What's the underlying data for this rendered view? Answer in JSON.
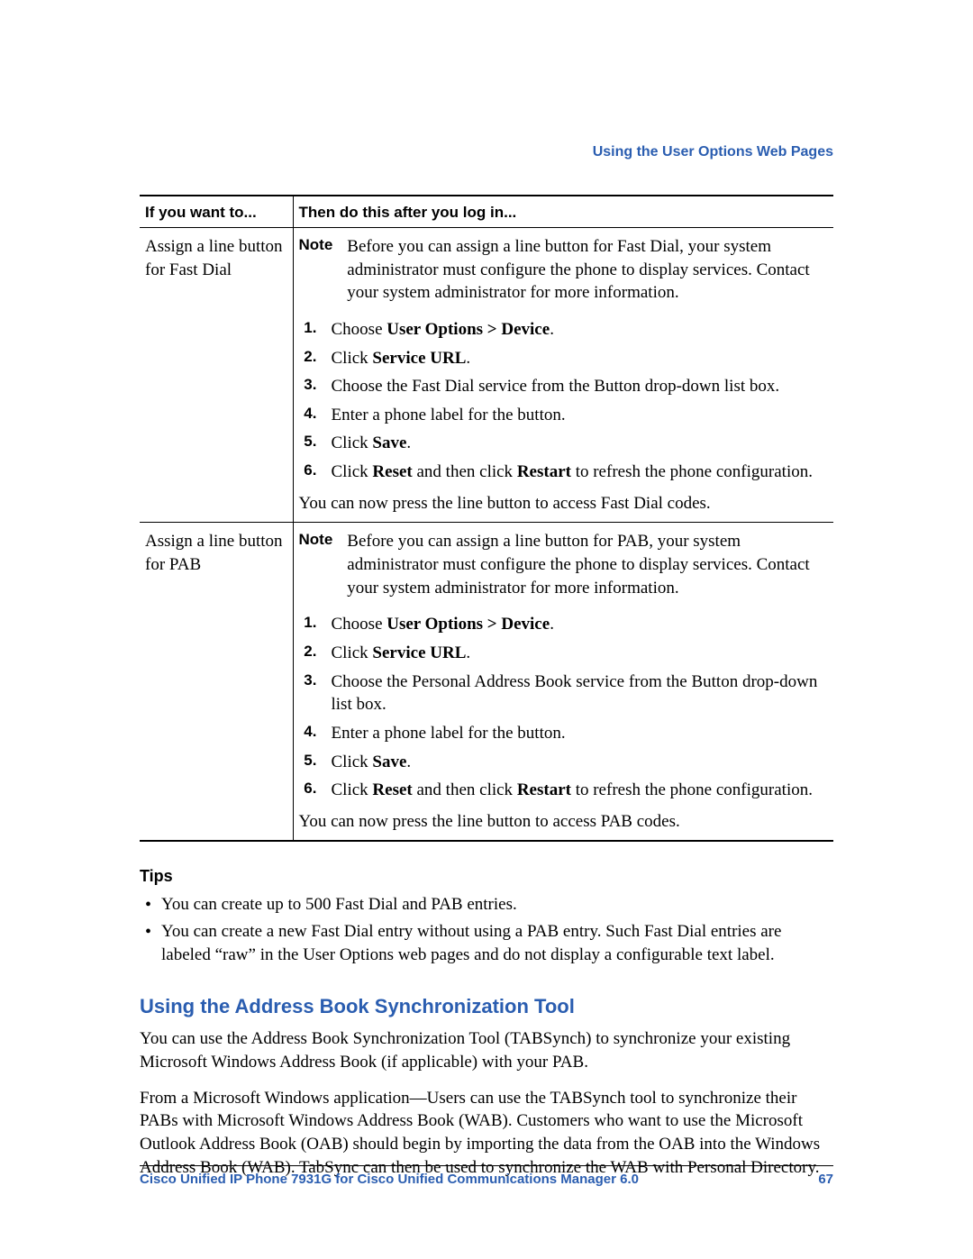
{
  "header": {
    "link": "Using the User Options Web Pages"
  },
  "table": {
    "headers": [
      "If you want to...",
      "Then do this after you log in..."
    ],
    "rows": [
      {
        "task": "Assign a line button for Fast Dial",
        "note_label": "Note",
        "note": "Before you can assign a line button for Fast Dial, your system administrator must configure the phone to display services. Contact your system administrator for more information.",
        "steps": [
          {
            "pre": "Choose ",
            "bold": "User Options > Device",
            "post": "."
          },
          {
            "pre": "Click ",
            "bold": "Service URL",
            "post": "."
          },
          {
            "pre": "Choose the Fast Dial service from the Button drop-down list box.",
            "bold": "",
            "post": ""
          },
          {
            "pre": "Enter a phone label for the button.",
            "bold": "",
            "post": ""
          },
          {
            "pre": "Click ",
            "bold": "Save",
            "post": "."
          },
          {
            "pre": "Click ",
            "bold": "Reset",
            "mid": " and then click ",
            "bold2": "Restart",
            "post": " to refresh the phone configuration."
          }
        ],
        "after": "You can now press the line button to access Fast Dial codes."
      },
      {
        "task": "Assign a line button for PAB",
        "note_label": "Note",
        "note": "Before you can assign a line button for PAB, your system administrator must configure the phone to display services. Contact your system administrator for more information.",
        "steps": [
          {
            "pre": "Choose ",
            "bold": "User Options > Device",
            "post": "."
          },
          {
            "pre": "Click ",
            "bold": "Service URL",
            "post": "."
          },
          {
            "pre": "Choose the Personal Address Book service from the Button drop-down list box.",
            "bold": "",
            "post": ""
          },
          {
            "pre": "Enter a phone label for the button.",
            "bold": "",
            "post": ""
          },
          {
            "pre": "Click ",
            "bold": "Save",
            "post": "."
          },
          {
            "pre": "Click ",
            "bold": "Reset",
            "mid": " and then click ",
            "bold2": "Restart",
            "post": " to refresh the phone configuration."
          }
        ],
        "after": "You can now press the line button to access PAB codes."
      }
    ]
  },
  "tips": {
    "heading": "Tips",
    "items": [
      "You can create up to 500 Fast Dial and PAB entries.",
      "You can create a new Fast Dial entry without using a PAB entry. Such Fast Dial entries are labeled “raw” in the User Options web pages and do not display a configurable text label."
    ]
  },
  "section": {
    "heading": "Using the Address Book Synchronization Tool",
    "p1": "You can use the Address Book Synchronization Tool (TABSynch) to synchronize your existing Microsoft Windows Address Book (if applicable) with your PAB.",
    "p2": "From a Microsoft Windows application—Users can use the TABSynch tool to synchronize their PABs with Microsoft Windows Address Book (WAB). Customers who want to use the Microsoft Outlook Address Book (OAB) should begin by importing the data from the OAB into the Windows Address Book (WAB).  TabSync can then be used to synchronize the WAB with Personal Directory."
  },
  "footer": {
    "title": "Cisco Unified IP Phone 7931G for Cisco Unified Communications Manager 6.0",
    "page": "67"
  }
}
